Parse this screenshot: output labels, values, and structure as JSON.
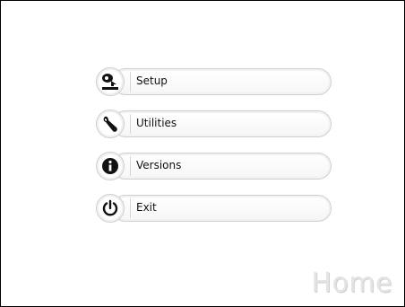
{
  "menu": {
    "items": [
      {
        "label": "Setup",
        "icon": "setup-icon"
      },
      {
        "label": "Utilities",
        "icon": "wrench-icon"
      },
      {
        "label": "Versions",
        "icon": "info-icon"
      },
      {
        "label": "Exit",
        "icon": "power-icon"
      }
    ]
  },
  "page": {
    "title": "Home"
  },
  "colors": {
    "text": "#111111",
    "watermark": "#e4e4e4",
    "border": "#cfcfcf"
  }
}
